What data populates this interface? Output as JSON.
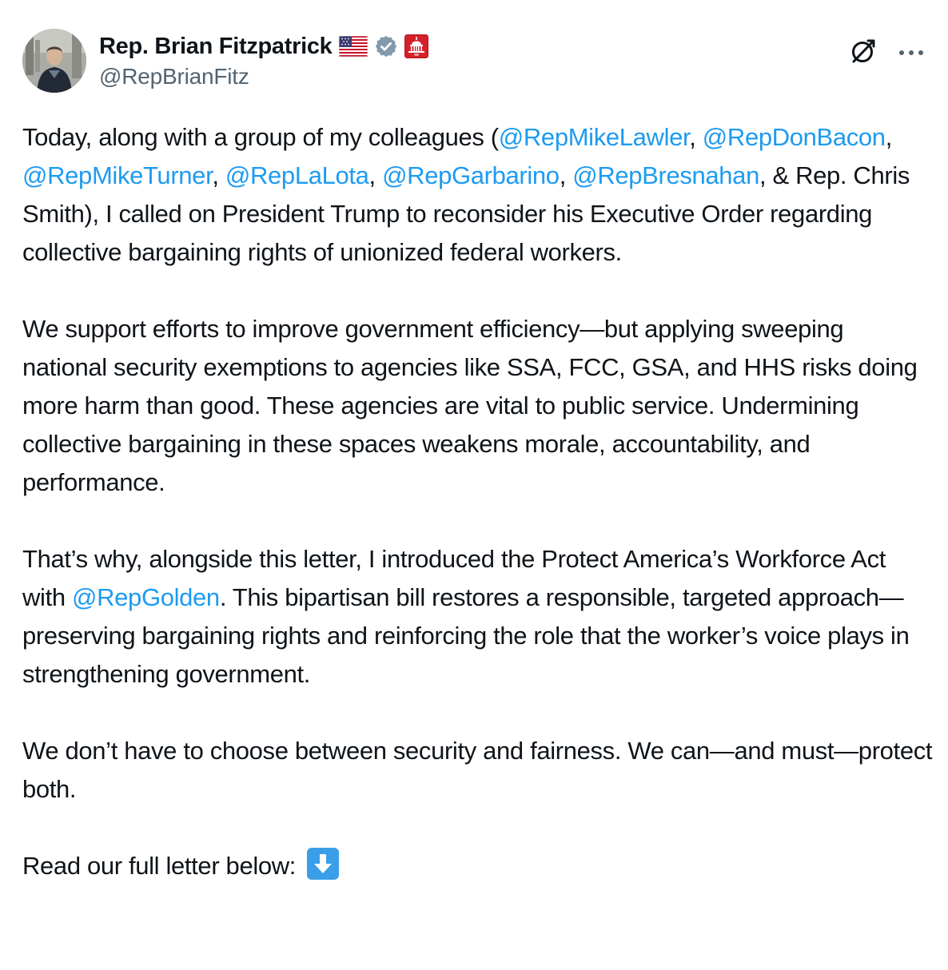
{
  "author": {
    "display_name": "Rep. Brian Fitzpatrick",
    "handle": "@RepBrianFitz",
    "badges": [
      "us-flag-icon",
      "verified-gov-badge-icon",
      "capitol-building-icon"
    ]
  },
  "actions": {
    "grok_icon": "grok-icon",
    "more_icon": "more-icon"
  },
  "colors": {
    "mention": "#1d9bf0",
    "text": "#0f1419",
    "secondary": "#536471"
  },
  "tweet": {
    "p1": {
      "t1": "Today, along with a group of my colleagues (",
      "m1": "@RepMikeLawler",
      "t2": ", ",
      "m2": "@RepDonBacon",
      "t3": ", ",
      "m3": "@RepMikeTurner",
      "t4": ", ",
      "m4": "@RepLaLota",
      "t5": ", ",
      "m5": "@RepGarbarino",
      "t6": ", ",
      "m6": "@RepBresnahan",
      "t7": ", & Rep. Chris Smith), I called on President Trump to reconsider his Executive Order regarding collective bargaining rights of unionized federal workers."
    },
    "p2": "We support efforts to improve government efficiency—but applying sweeping national security exemptions to agencies like SSA, FCC, GSA, and HHS risks doing more harm than good. These agencies are vital to public service. Undermining collective bargaining in these spaces weakens morale, accountability, and performance.",
    "p3": {
      "t1": "That’s why, alongside this letter, I introduced the Protect America’s Workforce Act with ",
      "m1": "@RepGolden",
      "t2": ". This bipartisan bill restores a responsible, targeted approach—preserving bargaining rights and reinforcing the role that the worker’s voice plays in strengthening government."
    },
    "p4": "We don’t have to choose between security and fairness. We can—and must—protect both.",
    "p5": {
      "text": "Read our full letter below: ",
      "emoji": "down-arrow-emoji-icon"
    }
  }
}
